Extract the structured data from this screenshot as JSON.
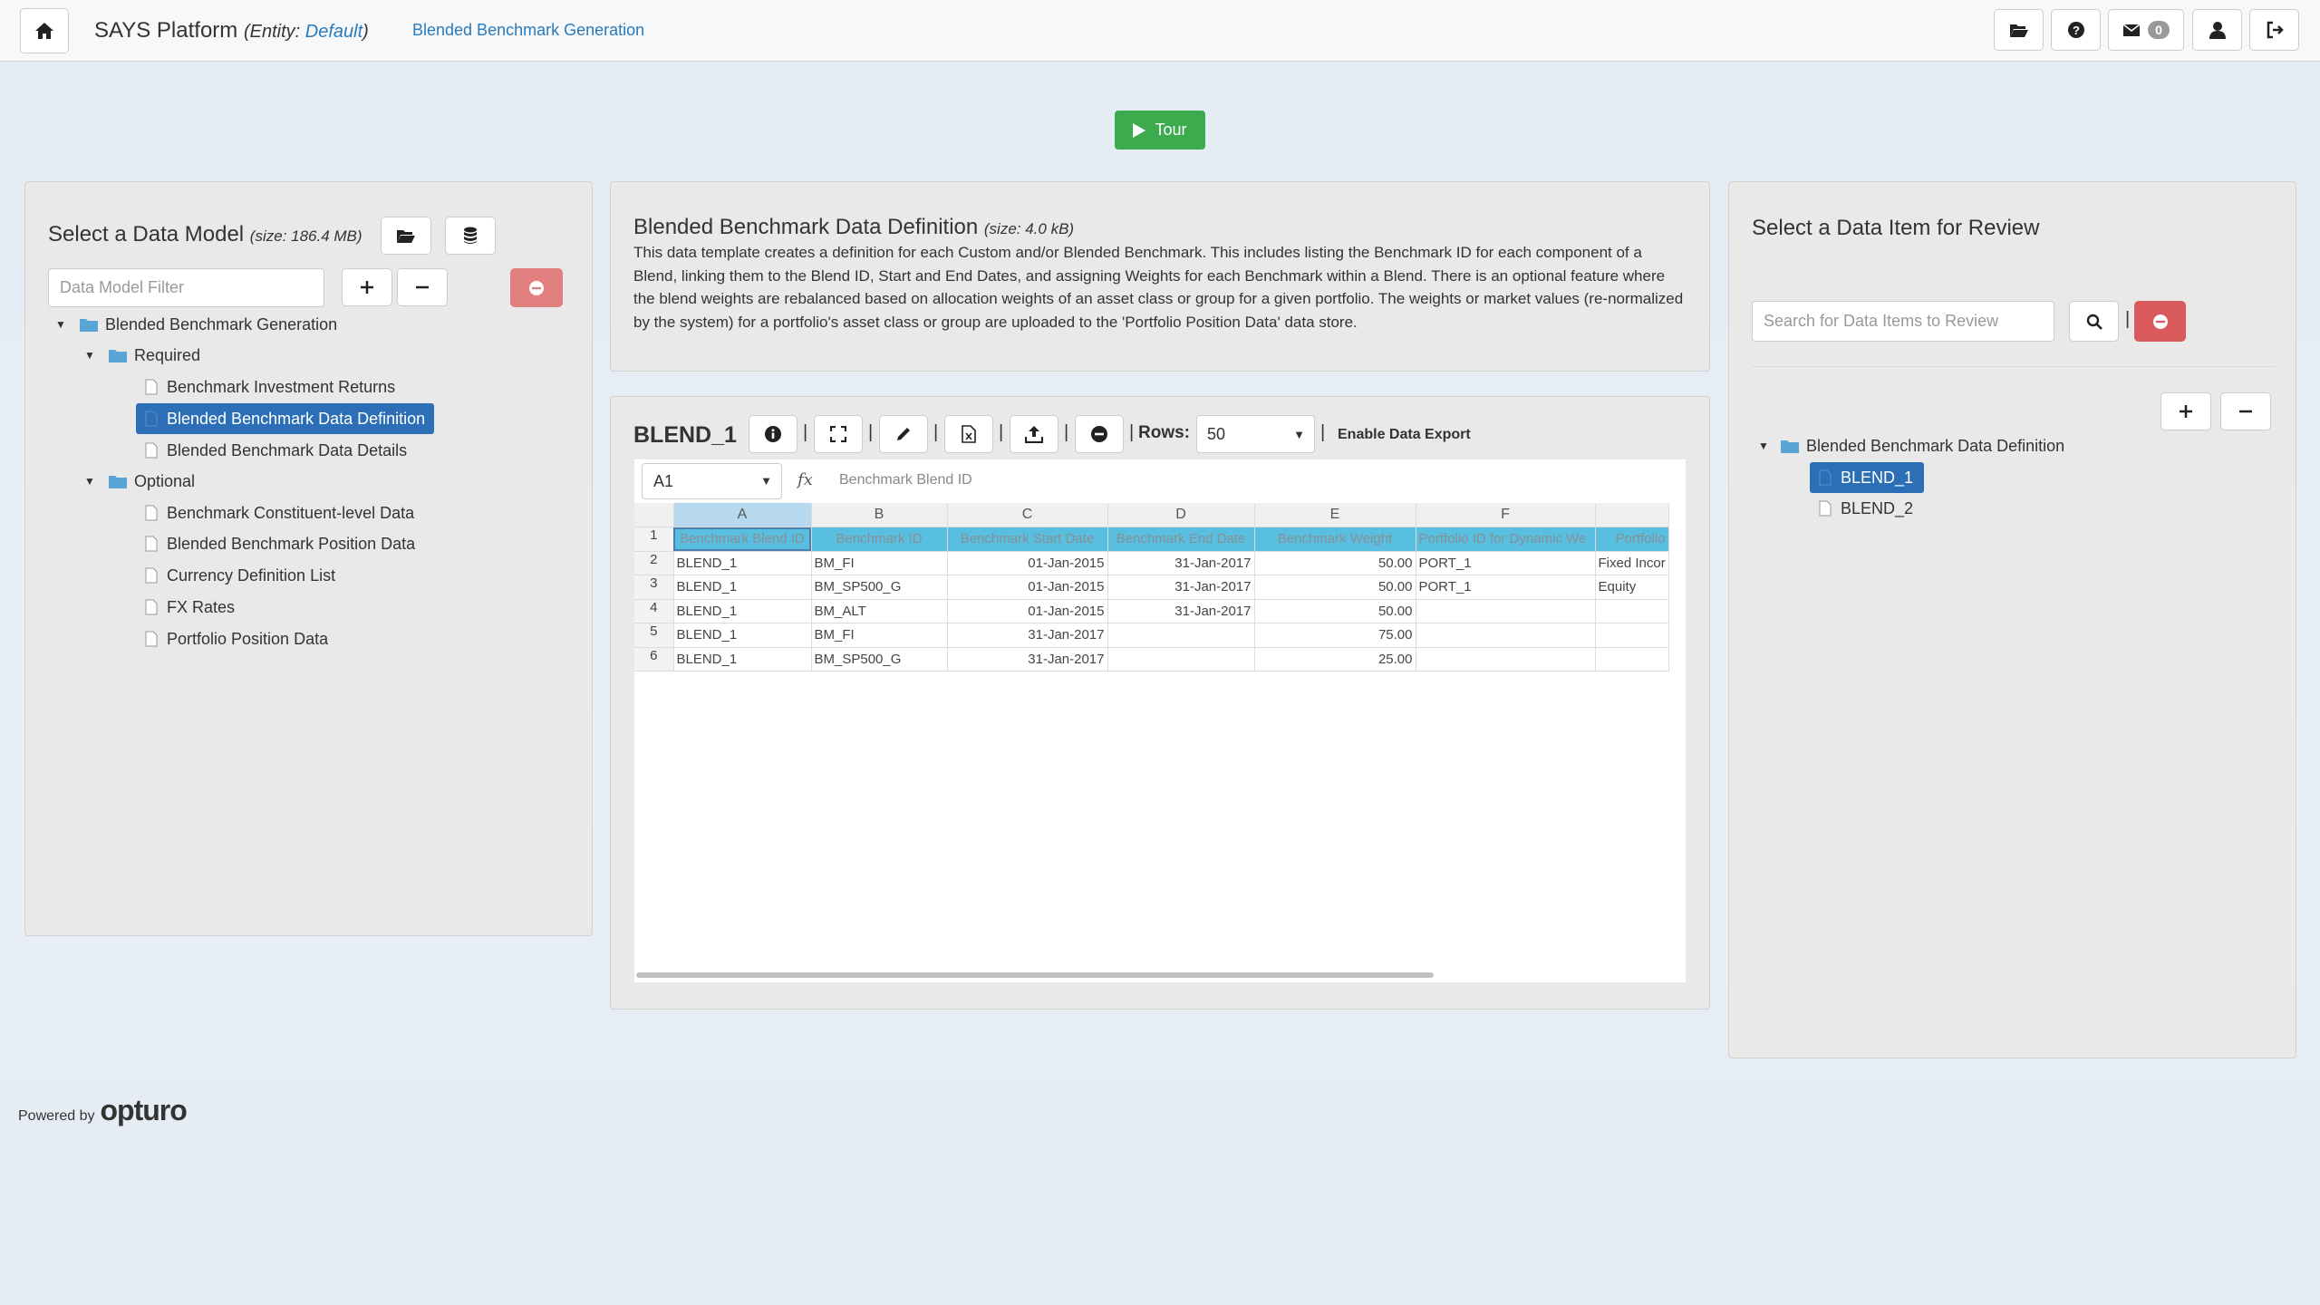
{
  "navbar": {
    "brand": "SAYS Platform",
    "entity_prefix": "(Entity:",
    "entity_value": "Default",
    "entity_suffix": ")",
    "breadcrumb": "Blended Benchmark Generation",
    "mail_count": "0"
  },
  "tour_label": "Tour",
  "left_panel": {
    "title": "Select a Data Model",
    "size": "(size: 186.4 MB)",
    "filter_placeholder": "Data Model Filter",
    "tree": {
      "root": "Blended Benchmark Generation",
      "required_label": "Required",
      "required_items": [
        "Benchmark Investment Returns",
        "Blended Benchmark Data Definition",
        "Blended Benchmark Data Details"
      ],
      "optional_label": "Optional",
      "optional_items": [
        "Benchmark Constituent-level Data",
        "Blended Benchmark Position Data",
        "Currency Definition List",
        "FX Rates",
        "Portfolio Position Data"
      ]
    }
  },
  "middle": {
    "title": "Blended Benchmark Data Definition",
    "size": "(size: 4.0 kB)",
    "description": "This data template creates a definition for each Custom and/or Blended Benchmark. This includes listing the Benchmark ID for each component of a Blend, linking them to the Blend ID, Start and End Dates, and assigning Weights for each Benchmark within a Blend. There is an optional feature where the blend weights are rebalanced based on allocation weights of an asset class or group for a given portfolio. The weights or market values (re-normalized by the system) for a portfolio's asset class or group are uploaded to the 'Portfolio Position Data' data store.",
    "sheet_name": "BLEND_1",
    "rows_label": "Rows:",
    "rows_value": "50",
    "export_label": "Enable Data Export",
    "pipe": "|",
    "cell_ref": "A1",
    "fx_label": "fx",
    "formula_value": "Benchmark Blend ID",
    "columns": [
      "A",
      "B",
      "C",
      "D",
      "E",
      "F",
      ""
    ],
    "row_numbers": [
      "1",
      "2",
      "3",
      "4",
      "5",
      "6"
    ],
    "header_row": [
      "Benchmark Blend ID",
      "Benchmark ID",
      "Benchmark Start Date",
      "Benchmark End Date",
      "Benchmark Weight",
      "Portfolio ID for Dynamic We",
      "Portfolio"
    ],
    "rows": [
      [
        "BLEND_1",
        "BM_FI",
        "01-Jan-2015",
        "31-Jan-2017",
        "50.00",
        "PORT_1",
        "Fixed Incor"
      ],
      [
        "BLEND_1",
        "BM_SP500_G",
        "01-Jan-2015",
        "31-Jan-2017",
        "50.00",
        "PORT_1",
        "Equity"
      ],
      [
        "BLEND_1",
        "BM_ALT",
        "01-Jan-2015",
        "31-Jan-2017",
        "50.00",
        "",
        ""
      ],
      [
        "BLEND_1",
        "BM_FI",
        "31-Jan-2017",
        "",
        "75.00",
        "",
        ""
      ],
      [
        "BLEND_1",
        "BM_SP500_G",
        "31-Jan-2017",
        "",
        "25.00",
        "",
        ""
      ]
    ]
  },
  "right_panel": {
    "title": "Select a Data Item for Review",
    "search_placeholder": "Search for Data Items to Review",
    "pipe": "|",
    "tree_root": "Blended Benchmark Data Definition",
    "items": [
      "BLEND_1",
      "BLEND_2"
    ]
  },
  "footer": {
    "powered_by": "Powered by",
    "logo_text": "opturo"
  },
  "colors": {
    "accent": "#2c6fb6",
    "link": "#2a7ab9",
    "tour_green": "#3cab4e",
    "danger": "#d85a5a",
    "header_row": "#58bfe0",
    "folder": "#5aa5d6"
  }
}
